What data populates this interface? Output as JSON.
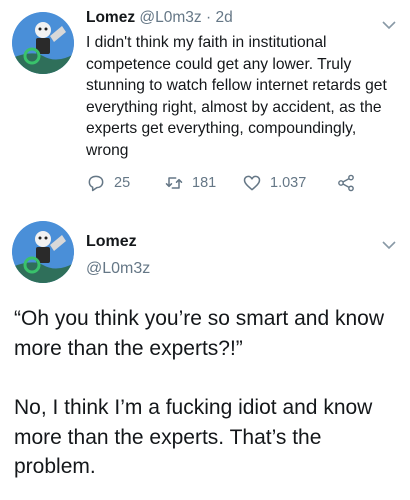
{
  "colors": {
    "text": "#14171a",
    "muted": "#657786",
    "avatar_bg": "#4a8fd8"
  },
  "icons": {
    "reply": "reply-icon",
    "retweet": "retweet-icon",
    "like": "heart-icon",
    "share": "share-icon",
    "menu": "chevron-down-icon"
  },
  "tweet1": {
    "name": "Lomez",
    "handle": "@L0m3z",
    "time": "· 2d",
    "text": "I didn't think my faith in institutional competence could get any lower. Truly stunning to watch fellow internet retards get everything right, almost by accident, as the experts get everything, compoundingly, wrong",
    "reply_count": "25",
    "retweet_count": "181",
    "like_count": "1.037"
  },
  "tweet2": {
    "name": "Lomez",
    "handle": "@L0m3z",
    "paragraph1": "“Oh you think you’re so smart and know more than the experts?!”",
    "paragraph2": "No, I think I’m a fucking idiot and know more than the experts. That’s the problem."
  }
}
